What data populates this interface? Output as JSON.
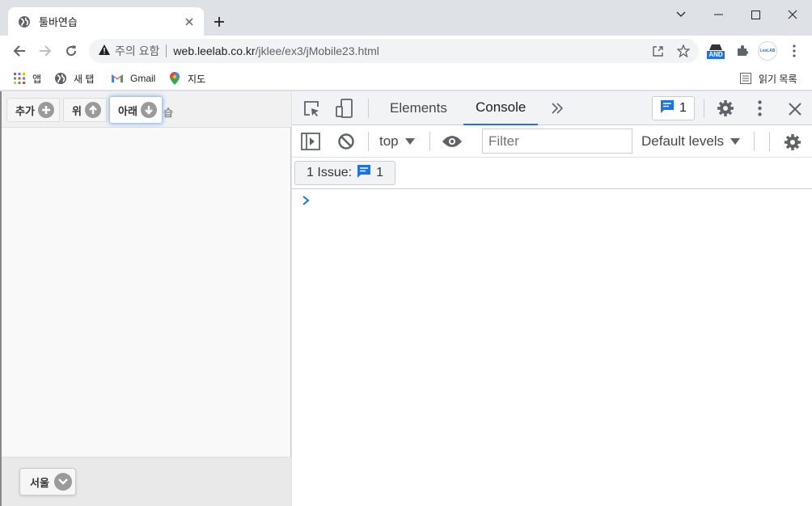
{
  "browser": {
    "tab_title": "툴바연습",
    "omnibox": {
      "security_label": "주의 요함",
      "url_host": "web.leelab.co.kr",
      "url_path": "/jklee/ex3/jMobile23.html"
    },
    "extensions": {
      "and_badge": "AND",
      "leelab_label": "LeeLAB"
    },
    "bookmarks": [
      {
        "label": "앱"
      },
      {
        "label": "새 탭"
      },
      {
        "label": "Gmail"
      },
      {
        "label": "지도"
      }
    ],
    "reading_list": "읽기 목록"
  },
  "page": {
    "toolbar_buttons": [
      {
        "label": "추가",
        "icon": "plus-icon"
      },
      {
        "label": "위",
        "icon": "arrow-up-icon"
      },
      {
        "label": "아래",
        "icon": "arrow-down-icon"
      }
    ],
    "hidden_partial_label": "습",
    "footer_button": {
      "label": "서울",
      "icon": "chevron-down-icon"
    }
  },
  "devtools": {
    "tabs": [
      {
        "label": "Elements",
        "active": false
      },
      {
        "label": "Console",
        "active": true
      }
    ],
    "issue_count": "1",
    "context": "top",
    "filter_placeholder": "Filter",
    "levels": "Default levels",
    "issues_button_label": "1 Issue:",
    "issues_button_count": "1",
    "accent": "#1a73e8"
  }
}
